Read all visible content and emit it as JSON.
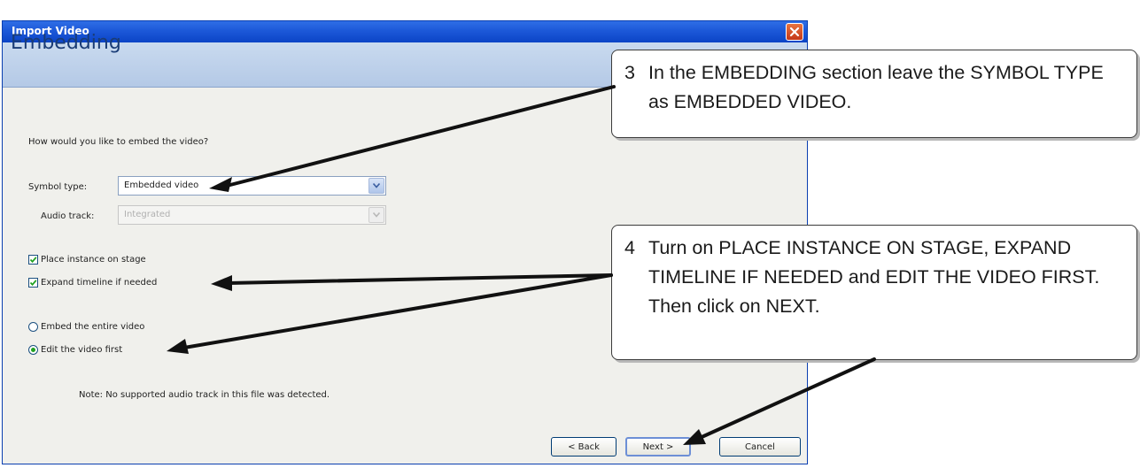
{
  "window": {
    "title": "Import Video",
    "section": "Embedding"
  },
  "form": {
    "question": "How would you like to embed the video?",
    "symbol_type_label": "Symbol type:",
    "symbol_type_value": "Embedded video",
    "audio_track_label": "Audio track:",
    "audio_track_value": "Integrated",
    "place_instance_label": "Place instance on stage",
    "expand_timeline_label": "Expand timeline if needed",
    "embed_entire_label": "Embed the entire video",
    "edit_first_label": "Edit the video first",
    "note": "Note: No supported audio track in this file was detected."
  },
  "states": {
    "place_instance_checked": true,
    "expand_timeline_checked": true,
    "selected_option": "Edit the video first"
  },
  "buttons": {
    "back": "< Back",
    "next": "Next >",
    "cancel": "Cancel"
  },
  "callouts": {
    "c3": {
      "number": "3",
      "text": "In the EMBEDDING section leave the SYMBOL TYPE as EMBEDDED VIDEO."
    },
    "c4": {
      "number": "4",
      "text": "Turn on PLACE INSTANCE ON STAGE, EXPAND TIMELINE IF NEEDED and EDIT THE VIDEO FIRST.  Then click on NEXT."
    }
  },
  "icons": {
    "close": "close-icon",
    "dropdown": "chevron-down-icon",
    "check": "checkmark-icon",
    "radio": "radio-dot-icon"
  },
  "colors": {
    "title_bar": "#1c58d8",
    "close_button": "#d8532b",
    "header_band": "#c9daef",
    "section_title": "#1a3c76",
    "radio_dot": "#21a121"
  }
}
